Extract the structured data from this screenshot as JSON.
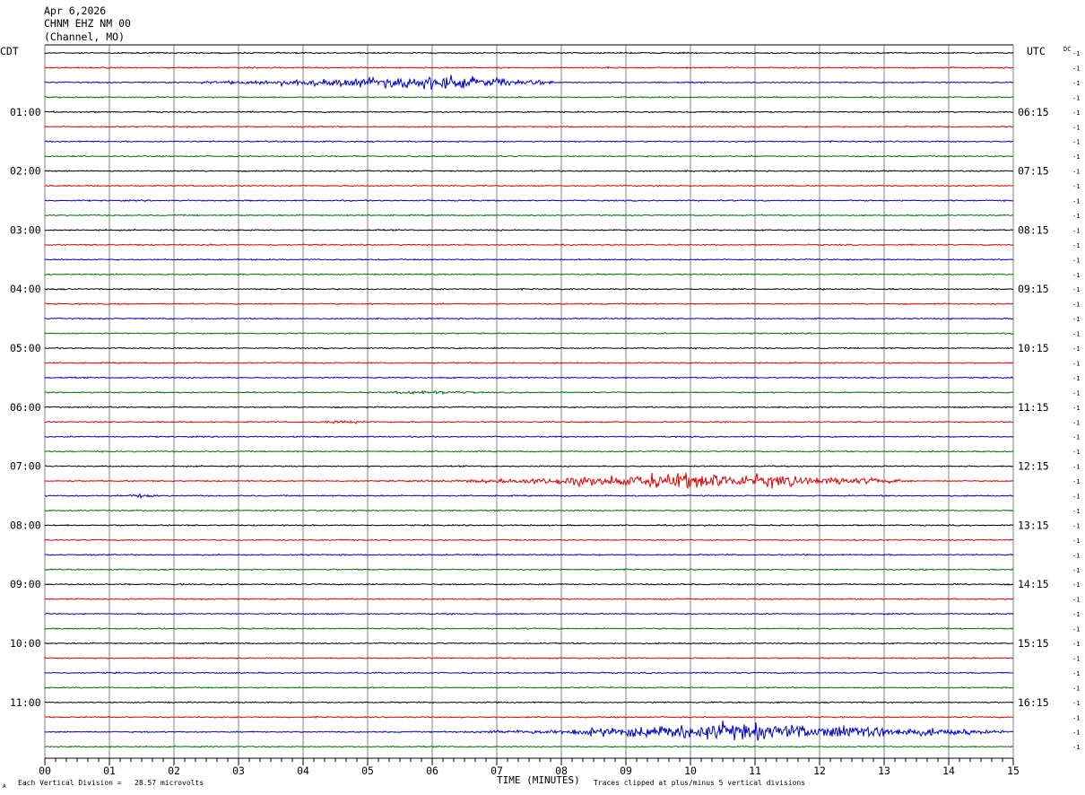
{
  "header": {
    "date": "Apr 6,2026",
    "station": "CHNM EHZ NM 00",
    "channel": "(Channel, MO)"
  },
  "left_timezone": "CDT",
  "right_timezone": "UTC",
  "dc_label": "DC",
  "offset_label": "-1",
  "footer": {
    "scale_note": "Each Vertical Division =   28.57 microvolts",
    "x_axis_title": "TIME (MINUTES)",
    "clip_note": "Traces clipped at plus/minus 5 vertical divisions",
    "corner_mark": "A"
  },
  "colors": {
    "trace_cycle": [
      "#000000",
      "#e00000",
      "#0000c8",
      "#007000"
    ],
    "grid": "#808080",
    "text": "#000000"
  },
  "chart_data": {
    "type": "line",
    "title": "CHNM EHZ NM 00",
    "xlabel": "TIME (MINUTES)",
    "ylabel": "",
    "xlim": [
      0,
      15
    ],
    "x_ticks": [
      "00",
      "01",
      "02",
      "03",
      "04",
      "05",
      "06",
      "07",
      "08",
      "09",
      "10",
      "11",
      "12",
      "13",
      "14",
      "15"
    ],
    "row_count": 48,
    "minutes_per_row": 15,
    "start_time_cdt": "00:15",
    "left_hour_labels": [
      "01:00",
      "02:00",
      "03:00",
      "04:00",
      "05:00",
      "06:00",
      "07:00",
      "08:00",
      "09:00",
      "10:00",
      "11:00"
    ],
    "right_hour_labels": [
      "06:15",
      "07:15",
      "08:15",
      "09:15",
      "10:15",
      "11:15",
      "12:15",
      "13:15",
      "14:15",
      "15:15",
      "16:15"
    ],
    "first_hour_row": 4,
    "rows_per_hour": 4,
    "base_noise": 1.0,
    "events": [
      {
        "row": 2,
        "start_min": 1.5,
        "end_min": 8.0,
        "peak_min": 6.0,
        "amplitude": 12
      },
      {
        "row": 23,
        "start_min": 5.0,
        "end_min": 6.8,
        "peak_min": 5.8,
        "amplitude": 2.5
      },
      {
        "row": 25,
        "start_min": 4.0,
        "end_min": 5.2,
        "peak_min": 4.5,
        "amplitude": 2
      },
      {
        "row": 29,
        "start_min": 5.5,
        "end_min": 13.5,
        "peak_min": 9.9,
        "amplitude": 14
      },
      {
        "row": 30,
        "start_min": 1.2,
        "end_min": 1.8,
        "peak_min": 1.4,
        "amplitude": 3
      },
      {
        "row": 46,
        "start_min": 6.0,
        "end_min": 15.0,
        "peak_min": 10.5,
        "amplitude": 16
      }
    ]
  }
}
